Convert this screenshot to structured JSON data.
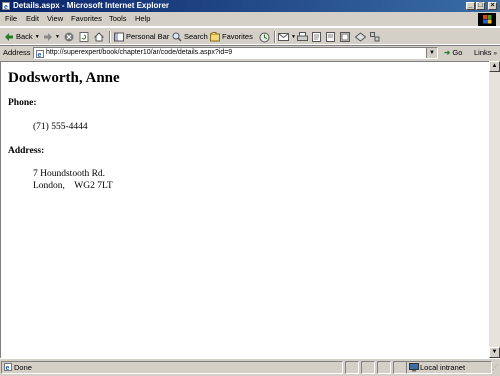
{
  "window": {
    "title": "Details.aspx - Microsoft Internet Explorer",
    "buttons": {
      "minimize": "_",
      "maximize": "□",
      "close": "×"
    }
  },
  "menu": [
    "File",
    "Edit",
    "View",
    "Favorites",
    "Tools",
    "Help"
  ],
  "toolbar": {
    "back": "Back",
    "personal_bar": "Personal Bar",
    "search": "Search",
    "favorites": "Favorites"
  },
  "address": {
    "label": "Address",
    "url": "http://superexpert/book/chapter10/ar/code/details.aspx?id=9",
    "go": "Go",
    "links": "Links"
  },
  "page": {
    "name": "Dodsworth, Anne",
    "phone_label": "Phone:",
    "phone": "(71) 555-4444",
    "address_label": "Address:",
    "address_line1": "7 Houndstooth Rd.",
    "address_line2": "London,    WG2 7LT"
  },
  "status": {
    "text": "Done",
    "zone": "Local intranet"
  },
  "colors": {
    "titlebar_start": "#0a246a",
    "titlebar_end": "#3a6ea5",
    "chrome": "#d4d0c8"
  }
}
